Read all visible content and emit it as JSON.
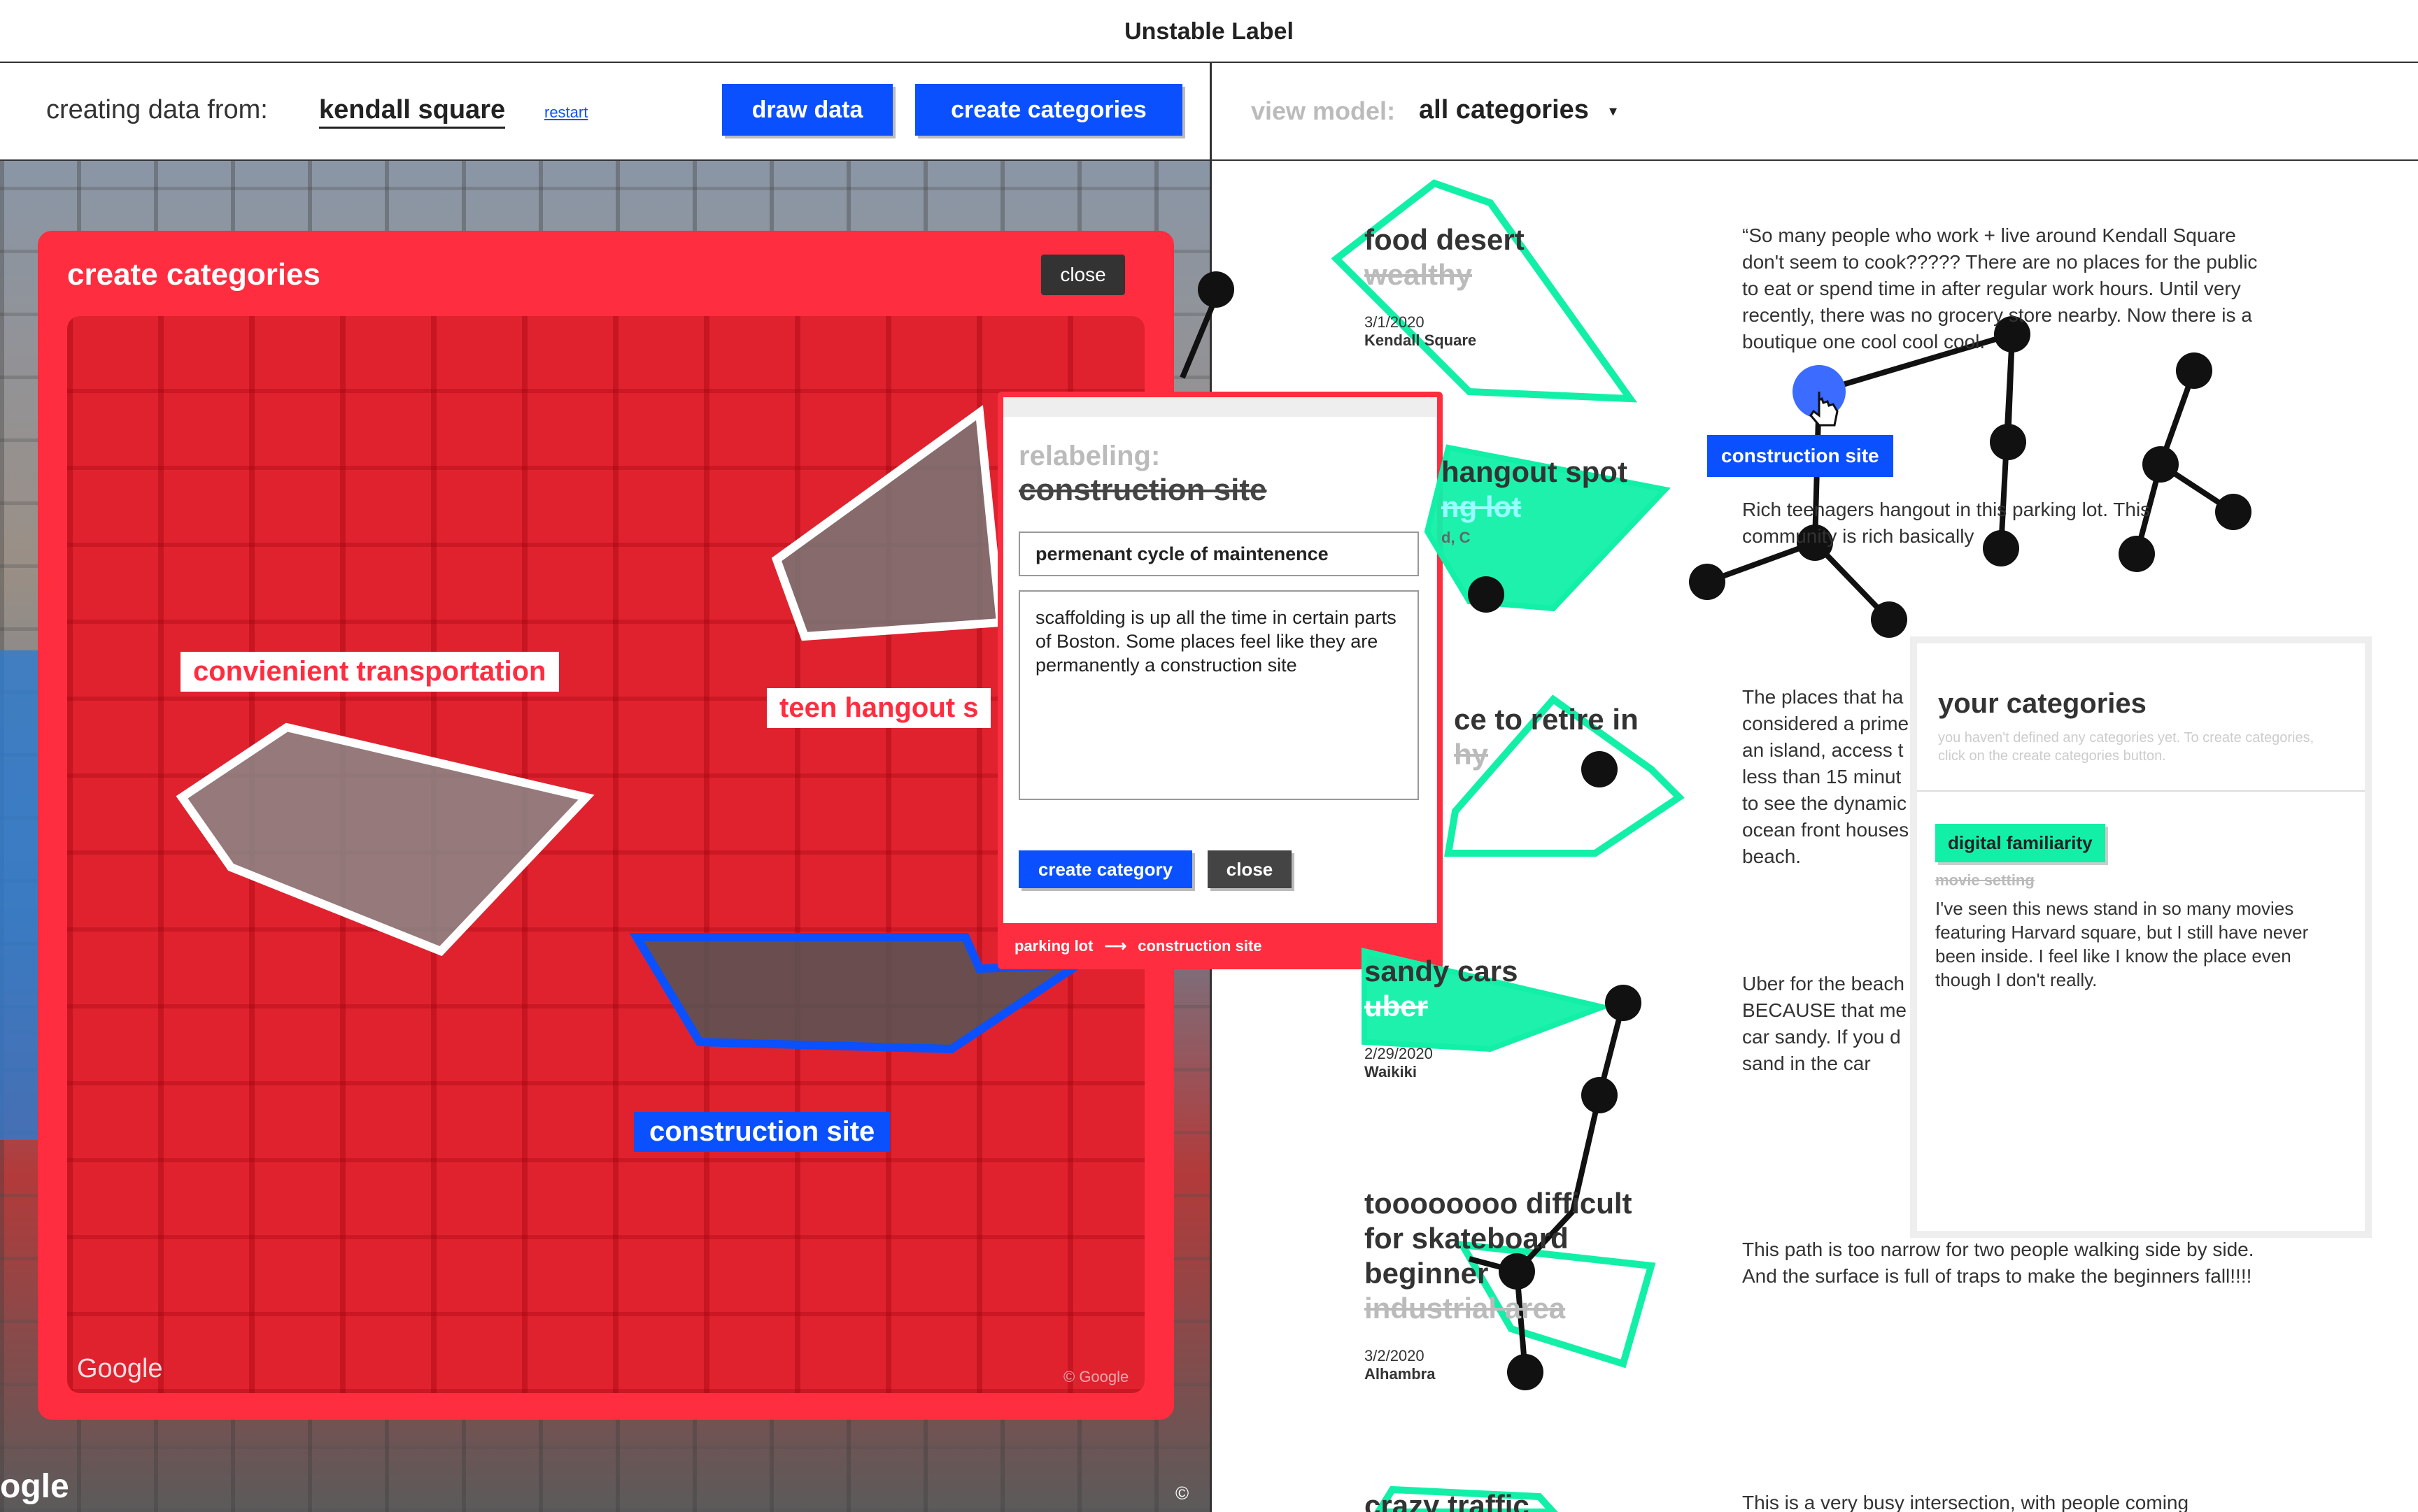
{
  "app": {
    "title": "Unstable Label"
  },
  "left_toolbar": {
    "creating_label": "creating data from:",
    "location": "kendall square",
    "restart": "restart",
    "draw_data": "draw data",
    "create_categories": "create categories"
  },
  "right_toolbar": {
    "view_model_label": "view model:",
    "view_model_value": "all categories"
  },
  "create_categories_panel": {
    "title": "create categories",
    "close": "close",
    "labels": {
      "convenient": "convienient transportation",
      "teen_hangout": "teen hangout s",
      "construction": "construction site"
    },
    "watermark": "Google",
    "copyright": "© Google"
  },
  "street_watermark": "ogle",
  "relabel_popup": {
    "heading": "relabeling:",
    "old_label": "construction site",
    "new_label_value": "permenant cycle of maintenence",
    "description_value": "scaffolding is up all the time in certain parts of Boston. Some places feel like they are permanently a construction site",
    "create_button": "create category",
    "close_button": "close",
    "footer_from": "parking lot",
    "footer_arrow": "⟶",
    "footer_to": "construction site"
  },
  "floating_label": "construction site",
  "items": [
    {
      "title": "food desert",
      "struck": "wealthy",
      "date": "3/1/2020",
      "place": "Kendall Square",
      "desc": "“So many people who work  + live around Kendall Square don't seem to cook????? There are no places for the public to eat or spend time in after regular work hours. Until very recently, there was no grocery store nearby. Now there is a boutique one cool cool cool."
    },
    {
      "title": "hangout spot",
      "struck": "ng lot",
      "date": "",
      "place": "d, C",
      "desc": "Rich teenagers hangout in this parking lot. This community is rich basically"
    },
    {
      "title": "ce to retire in",
      "struck": "hy",
      "date": "",
      "place": "",
      "desc": "The places that ha considered a prime an island, access t less than 15 minut to see the dynamic ocean front houses beach."
    },
    {
      "title": "sandy cars",
      "struck": "uber",
      "date": "2/29/2020",
      "place": "Waikiki",
      "desc": "Uber for the beach BECAUSE that me car sandy. If you d sand in the car"
    },
    {
      "title_lines": [
        "toooooooo difficult",
        "for skateboard",
        "beginner"
      ],
      "struck": "industrial area",
      "date": "3/2/2020",
      "place": "Alhambra",
      "desc": "This path is too narrow for two people walking side by side. And the surface is full of traps to make the beginners fall!!!!"
    },
    {
      "title": "crazy traffic",
      "desc": "This is a very busy intersection, with people coming"
    }
  ],
  "your_categories": {
    "title": "your categories",
    "hint": "you haven't defined any categories yet. To create categories, click on the create categories button.",
    "tag": "digital familiarity",
    "tag_struck": "movie setting",
    "tag_desc": "I've seen this news stand in so many movies featuring Harvard square, but I still have never been inside. I feel like I know the place even though I don't really."
  },
  "colors": {
    "accent_red": "#ff2d3f",
    "accent_blue": "#0a50ff",
    "accent_green": "#12f0a8"
  }
}
